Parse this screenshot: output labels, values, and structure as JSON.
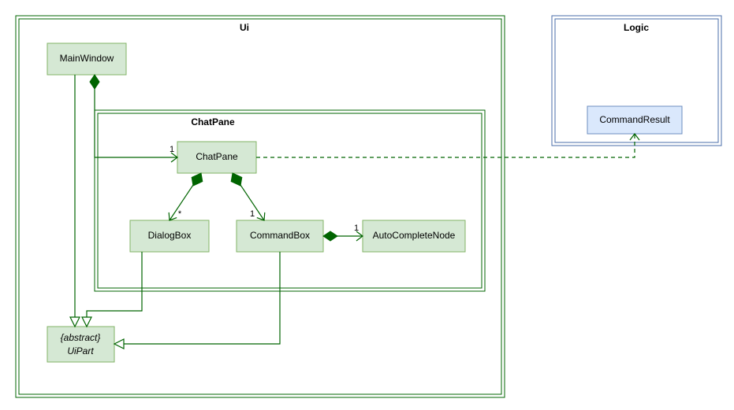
{
  "packages": {
    "ui": {
      "title": "Ui"
    },
    "chat": {
      "title": "ChatPane"
    },
    "logic": {
      "title": "Logic"
    }
  },
  "classes": {
    "mainWindow": {
      "label": "MainWindow"
    },
    "chatPane": {
      "label": "ChatPane"
    },
    "dialogBox": {
      "label": "DialogBox"
    },
    "commandBox": {
      "label": "CommandBox"
    },
    "autoComplete": {
      "label": "AutoCompleteNode"
    },
    "uiPart": {
      "stereotype": "{abstract}",
      "label": "UiPart"
    },
    "commandResult": {
      "label": "CommandResult"
    }
  },
  "multiplicities": {
    "mw_to_chat": "1",
    "chat_to_dialog": "*",
    "chat_to_cmd": "1",
    "cmd_to_auto": "1"
  },
  "chart_data": {
    "type": "uml-class-diagram",
    "packages": [
      {
        "name": "Ui",
        "contains": [
          "MainWindow",
          "UiPart",
          {
            "package": "ChatPane",
            "contains": [
              "ChatPane",
              "DialogBox",
              "CommandBox",
              "AutoCompleteNode"
            ]
          }
        ]
      },
      {
        "name": "Logic",
        "contains": [
          "CommandResult"
        ]
      }
    ],
    "relations": [
      {
        "from": "MainWindow",
        "to": "ChatPane",
        "type": "composition",
        "multiplicity_to": "1"
      },
      {
        "from": "ChatPane",
        "to": "DialogBox",
        "type": "composition",
        "multiplicity_to": "*"
      },
      {
        "from": "ChatPane",
        "to": "CommandBox",
        "type": "composition",
        "multiplicity_to": "1"
      },
      {
        "from": "CommandBox",
        "to": "AutoCompleteNode",
        "type": "composition",
        "multiplicity_to": "1"
      },
      {
        "from": "MainWindow",
        "to": "UiPart",
        "type": "generalization"
      },
      {
        "from": "DialogBox",
        "to": "UiPart",
        "type": "generalization"
      },
      {
        "from": "CommandBox",
        "to": "UiPart",
        "type": "generalization"
      },
      {
        "from": "ChatPane",
        "to": "CommandResult",
        "type": "dependency"
      }
    ]
  }
}
